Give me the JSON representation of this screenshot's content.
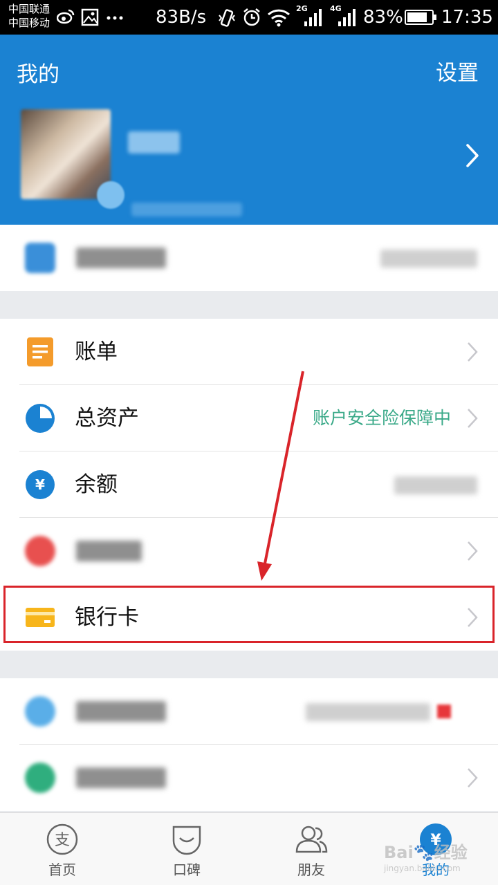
{
  "status_bar": {
    "carrier_1": "中国联通",
    "carrier_2": "中国移动",
    "net_speed": "83B/s",
    "signal_1_tag": "2G",
    "signal_2_tag": "4G",
    "battery": "83%",
    "battery_level": 0.83,
    "time": "17:35",
    "icons": [
      "weibo-icon",
      "gallery-icon",
      "more-icon",
      "vibrate-icon",
      "alarm-icon",
      "wifi-icon",
      "signal-icon",
      "battery-icon"
    ]
  },
  "header": {
    "title": "我的",
    "settings_label": "设置"
  },
  "menu": {
    "bill": "账单",
    "total_assets": "总资产",
    "total_assets_note": "账户安全险保障中",
    "balance": "余额",
    "bank_card": "银行卡"
  },
  "tabbar": {
    "tabs": [
      {
        "label": "首页",
        "icon": "home-icon"
      },
      {
        "label": "口碑",
        "icon": "koubei-icon"
      },
      {
        "label": "朋友",
        "icon": "friends-icon"
      },
      {
        "label": "我的",
        "icon": "yuan-icon"
      }
    ]
  },
  "colors": {
    "header_blue": "#1b82d2",
    "bill_orange": "#f49b2b",
    "assets_blue": "#1b82d2",
    "note_green": "#3aa988",
    "card_yellow": "#f7b51b",
    "highlight_red": "#d9242a"
  },
  "watermark": {
    "main": "Bai🐾经验",
    "sub": "jingyan.baidu.com"
  }
}
